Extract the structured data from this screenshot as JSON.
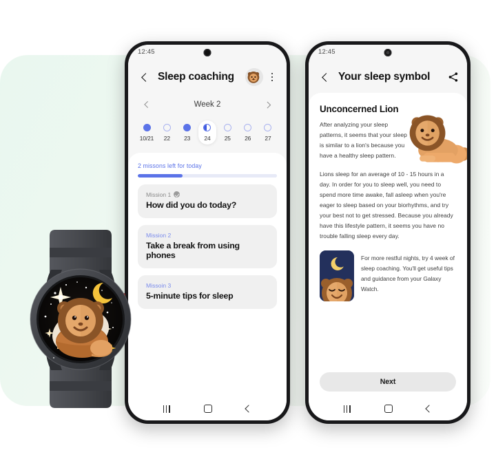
{
  "background": {
    "panel_color": "#eaf7ef",
    "page_color": "#ffffff"
  },
  "colors": {
    "accent_blue": "#5b73e8",
    "accent_blue_light": "#7b8ceb",
    "card_gray": "#f0f0f0",
    "screen_gray": "#f6f6f6",
    "lion_mane": "#8a5427",
    "lion_body": "#e09a5f",
    "night_navy": "#23305c",
    "moon_yellow": "#f5c33b",
    "watch_body": "#4a4c51"
  },
  "phone_left": {
    "status": {
      "time": "12:45",
      "camera_icon": "punch-hole-camera"
    },
    "appbar": {
      "back_icon": "chevron-left-icon",
      "title": "Sleep coaching",
      "avatar_icon": "lion-avatar",
      "menu_icon": "kebab-menu-icon"
    },
    "week": {
      "prev_icon": "chevron-left-icon",
      "label": "Week 2",
      "next_icon": "chevron-right-icon",
      "days": [
        {
          "label": "10/21",
          "state": "full"
        },
        {
          "label": "22",
          "state": "empty"
        },
        {
          "label": "23",
          "state": "full"
        },
        {
          "label": "24",
          "state": "half",
          "selected": true
        },
        {
          "label": "25",
          "state": "empty"
        },
        {
          "label": "26",
          "state": "empty"
        },
        {
          "label": "27",
          "state": "empty"
        }
      ]
    },
    "progress": {
      "label": "2 missons left for today",
      "segments": 3,
      "completed": 1
    },
    "missions": [
      {
        "kicker": "Mission 1",
        "title": "How did you do today?",
        "done": true,
        "kicker_style": "gray"
      },
      {
        "kicker": "Mission 2",
        "title": "Take a break from using phones",
        "done": false,
        "kicker_style": "blue"
      },
      {
        "kicker": "Missoin 3",
        "title": "5-minute tips for sleep",
        "done": false,
        "kicker_style": "blue"
      }
    ],
    "navbar": {
      "recent_icon": "recents-icon",
      "home_icon": "home-icon",
      "back_icon": "back-icon"
    }
  },
  "phone_right": {
    "status": {
      "time": "12:45",
      "camera_icon": "punch-hole-camera"
    },
    "appbar": {
      "back_icon": "chevron-left-icon",
      "title": "Your sleep symbol",
      "share_icon": "share-icon"
    },
    "article": {
      "title": "Unconcerned Lion",
      "hero_icon": "lion-illustration",
      "paragraph_1": "After analyzing your sleep patterns, it seems that your sleep is similar to a lion's because you have a healthy sleep pattern.",
      "paragraph_2": "Lions sleep for an average of 10 - 15 hours in a day. In order for you to sleep well, you need to spend more time awake, fall asleep when you're eager to sleep based on your biorhythms, and try your best not to get stressed. Because you already have this lifestyle pattern, it seems you have no trouble falling sleep every day."
    },
    "tip_card": {
      "thumb_icon": "sleeping-lion-night-icon",
      "text": "For more restful nights, try 4 week of sleep coaching. You'll get useful tips and guidance from your Galaxy Watch."
    },
    "next_button": "Next",
    "navbar": {
      "recent_icon": "recents-icon",
      "home_icon": "home-icon",
      "back_icon": "back-icon"
    }
  },
  "watch": {
    "face_icon": "lion-night-sky-watchface",
    "moon_icon": "crescent-moon-icon",
    "star_icon": "sparkle-star-icon"
  }
}
